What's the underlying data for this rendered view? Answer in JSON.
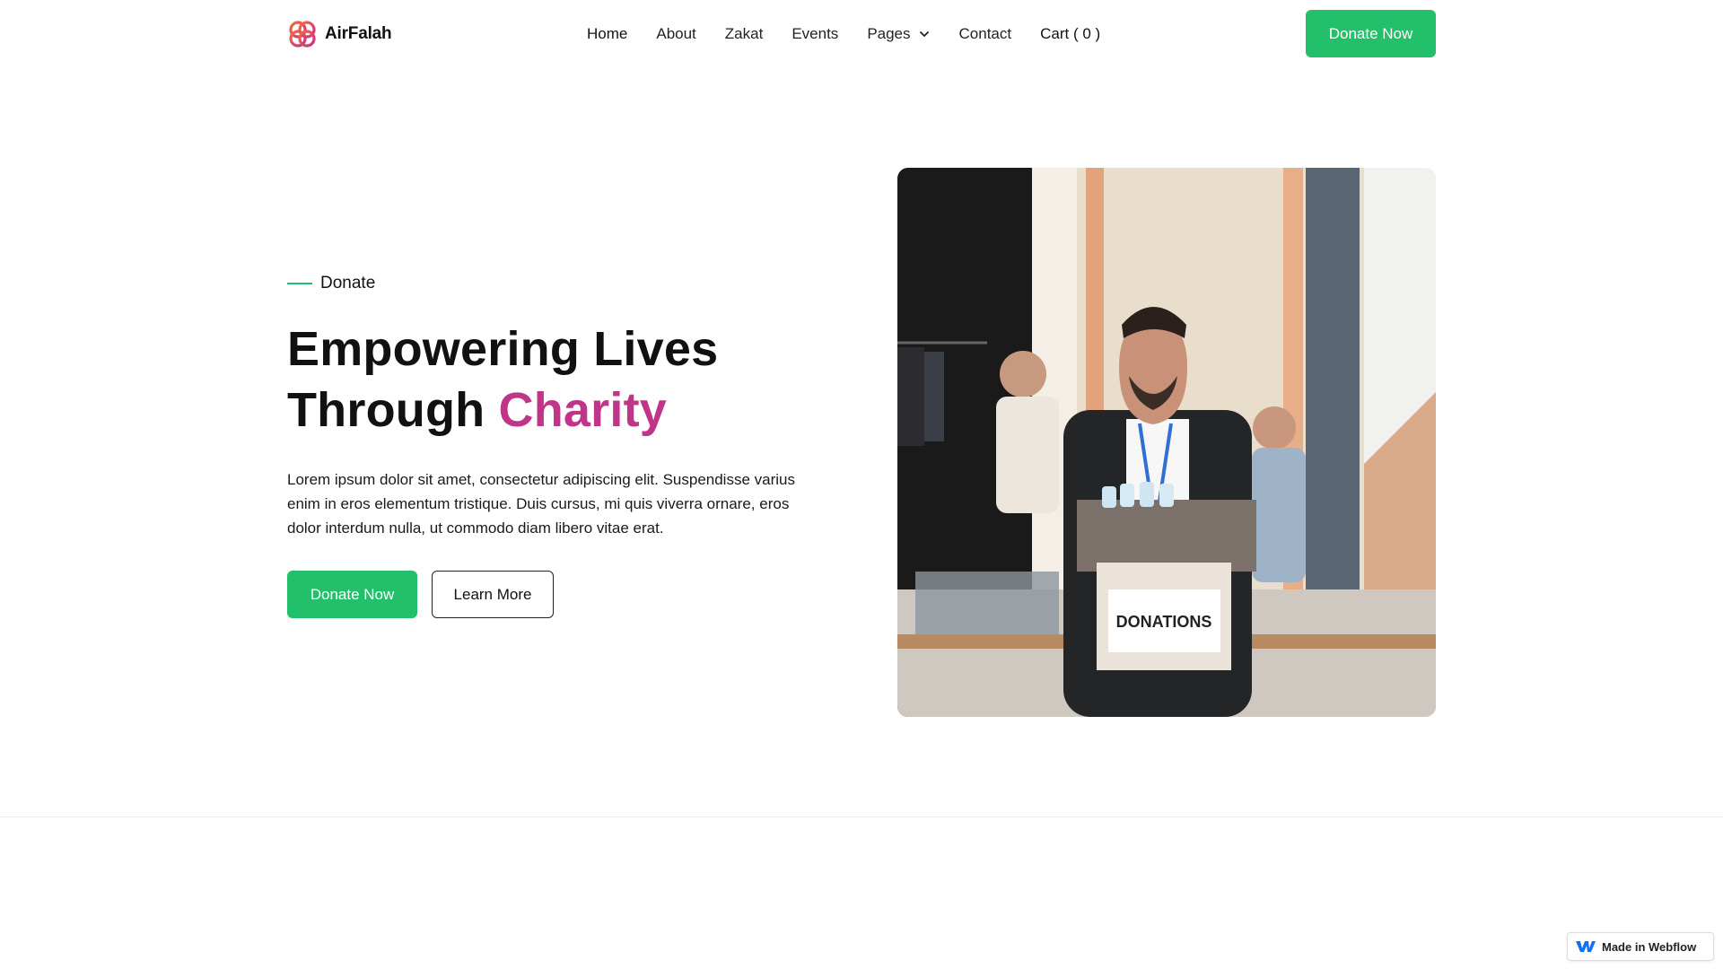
{
  "brand": {
    "name": "AirFalah",
    "colors": {
      "green": "#22c06a",
      "accent": "#c03587",
      "logo_orange": "#f26b3a",
      "logo_magenta": "#c7308a"
    }
  },
  "nav": {
    "items": [
      {
        "label": "Home"
      },
      {
        "label": "About"
      },
      {
        "label": "Zakat"
      },
      {
        "label": "Events"
      },
      {
        "label": "Pages",
        "icon": "chevron-down-icon"
      },
      {
        "label": "Contact"
      },
      {
        "label": "Cart ( 0 )"
      }
    ],
    "cta_label": "Donate Now"
  },
  "hero": {
    "eyebrow": "Donate",
    "headline_line1": "Empowering Lives",
    "headline_line2_plain": "Through ",
    "headline_line2_accent": "Charity",
    "description": "Lorem ipsum dolor sit amet, consectetur adipiscing elit. Suspendisse varius enim in eros elementum tristique. Duis cursus, mi quis viverra ornare, eros dolor interdum nulla, ut commodo diam libero vitae erat.",
    "primary_cta": "Donate Now",
    "secondary_cta": "Learn More",
    "image": {
      "box_label": "DONATIONS"
    }
  },
  "badge": {
    "label": "Made in Webflow",
    "icon": "webflow-icon"
  }
}
